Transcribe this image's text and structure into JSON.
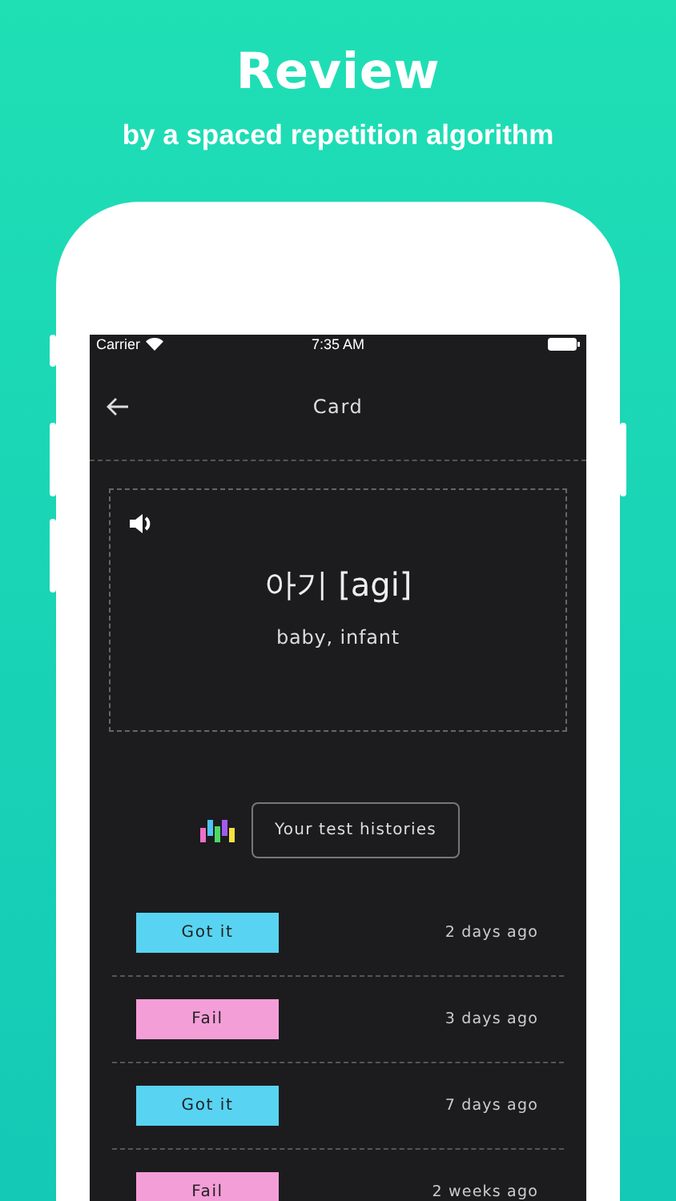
{
  "headline": "Review",
  "subheadline": "by a spaced repetition algorithm",
  "status_bar": {
    "carrier": "Carrier",
    "time": "7:35 AM"
  },
  "nav": {
    "title": "Card"
  },
  "card": {
    "word": "아기 [agi]",
    "meaning": "baby, infant"
  },
  "history_tip": "Your test histories",
  "history": [
    {
      "kind": "pass",
      "label": "Got it",
      "time": "2 days ago"
    },
    {
      "kind": "fail",
      "label": "Fail",
      "time": "3 days ago"
    },
    {
      "kind": "pass",
      "label": "Got it",
      "time": "7 days ago"
    },
    {
      "kind": "fail",
      "label": "Fail",
      "time": "2 weeks ago"
    }
  ]
}
